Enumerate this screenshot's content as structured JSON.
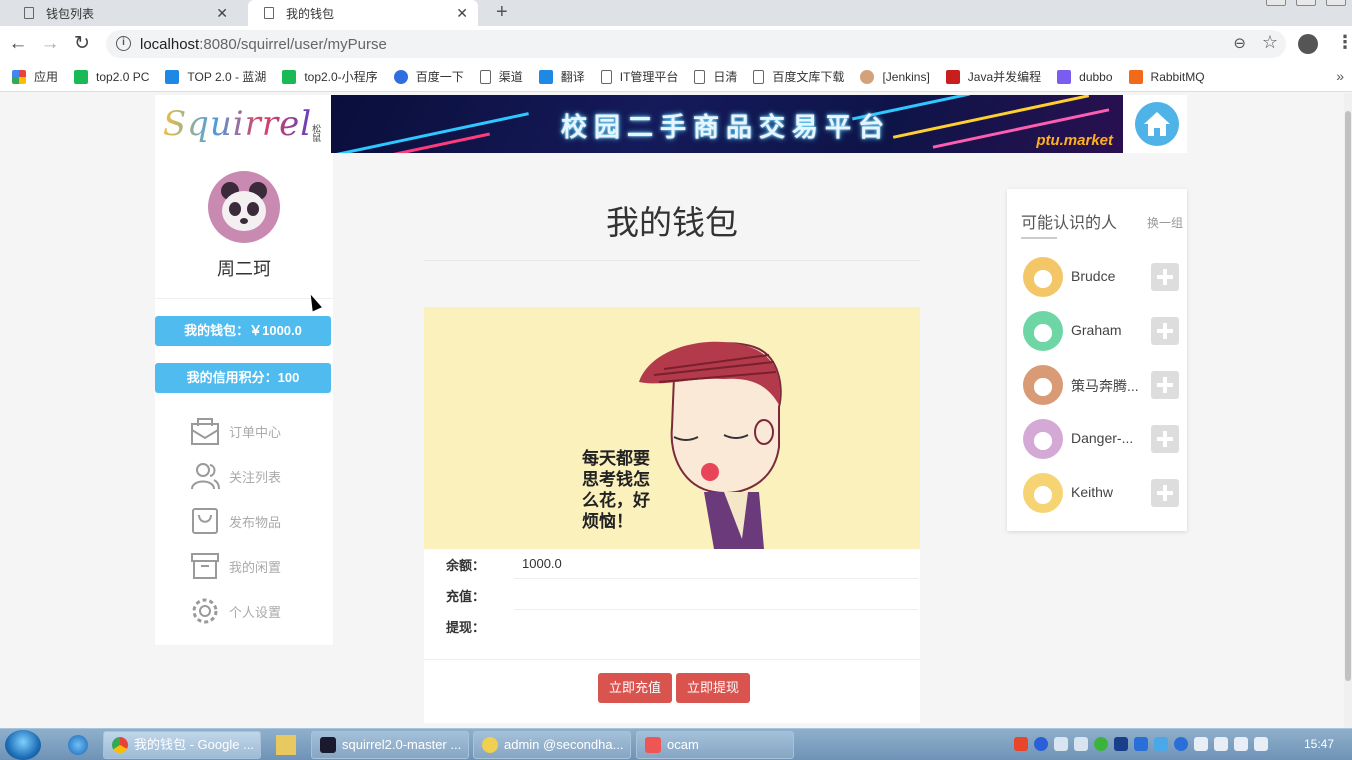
{
  "browser": {
    "tabs": [
      {
        "title": "钱包列表",
        "active": false
      },
      {
        "title": "我的钱包",
        "active": true
      }
    ],
    "url_host": "localhost",
    "url_path": ":8080/squirrel/user/myPurse",
    "bookmarks": [
      "应用",
      "top2.0 PC",
      "TOP 2.0 - 蓝湖",
      "top2.0-小程序",
      "百度一下",
      "渠道",
      "翻译",
      "IT管理平台",
      "日清",
      "百度文库下载",
      "[Jenkins]",
      "Java并发编程",
      "dubbo",
      "RabbitMQ"
    ]
  },
  "header": {
    "logo_text": "Squirrel",
    "logo_sub": "松鼠",
    "banner_text": "校园二手商品交易平台",
    "banner_badge": "ptu.market"
  },
  "sidebar": {
    "username": "周二珂",
    "wallet_pill": "我的钱包：￥1000.0",
    "credit_pill": "我的信用积分：100",
    "nav": [
      {
        "label": "订单中心",
        "icon": "mail-icon"
      },
      {
        "label": "关注列表",
        "icon": "users-icon"
      },
      {
        "label": "发布物品",
        "icon": "bag-icon"
      },
      {
        "label": "我的闲置",
        "icon": "archive-icon"
      },
      {
        "label": "个人设置",
        "icon": "gear-icon"
      }
    ]
  },
  "main": {
    "title": "我的钱包",
    "illustration_text": [
      "每天都要",
      "思考钱怎",
      "么花，好",
      "烦恼！"
    ],
    "balance_label": "余额：",
    "balance_value": "1000.0",
    "recharge_label": "充值：",
    "recharge_value": "",
    "withdraw_label": "提现：",
    "withdraw_value": "",
    "recharge_button": "立即充值",
    "withdraw_button": "立即提现"
  },
  "people": {
    "title": "可能认识的人",
    "swap_label": "换一组",
    "list": [
      {
        "name": "Brudce",
        "color": "#f3c768"
      },
      {
        "name": "Graham",
        "color": "#6dd6a4"
      },
      {
        "name": "策马奔腾...",
        "color": "#d99a76"
      },
      {
        "name": "Danger-...",
        "color": "#d4a9d6"
      },
      {
        "name": "Keithw",
        "color": "#f6d474"
      }
    ]
  },
  "taskbar": {
    "tasks": [
      "我的钱包 - Google ...",
      "squirrel2.0-master ...",
      "admin @secondha...",
      "ocam"
    ],
    "time": "15:47"
  },
  "colors": {
    "accent_blue": "#4fbbef",
    "button_red": "#d9534f"
  }
}
